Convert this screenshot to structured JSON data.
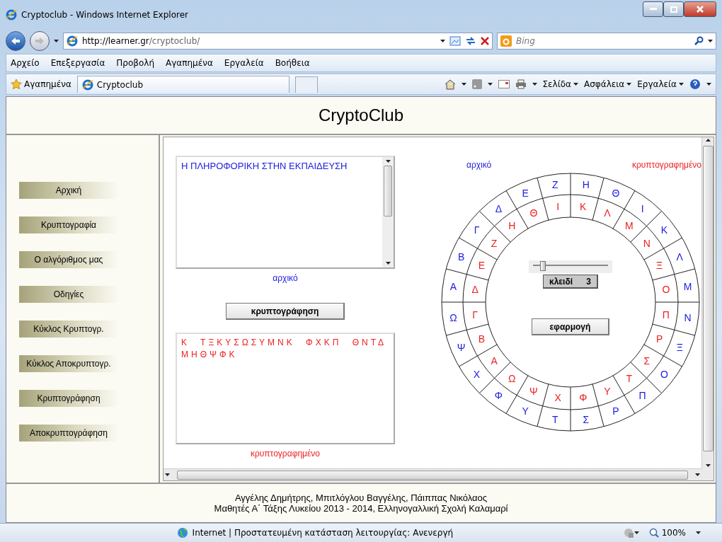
{
  "window": {
    "title": "Cryptoclub - Windows Internet Explorer"
  },
  "address_bar": {
    "url_host": "http://learner.gr",
    "url_path": "/cryptoclub/"
  },
  "search": {
    "placeholder": "Bing"
  },
  "menu": [
    "Αρχείο",
    "Επεξεργασία",
    "Προβολή",
    "Αγαπημένα",
    "Εργαλεία",
    "Βοήθεια"
  ],
  "favorites_bar": {
    "favorites": "Αγαπημένα",
    "tab": "Cryptoclub",
    "commands": [
      "Σελίδα",
      "Ασφάλεια",
      "Εργαλεία"
    ]
  },
  "page": {
    "title": "CryptoClub",
    "sidebar": {
      "items": [
        "Αρχική",
        "Κρυπτογραφία",
        "Ο αλγόριθμος μας",
        "Οδηγίες",
        "Κύκλος Κρυπτογρ.",
        "Κύκλος Αποκρυπτογρ.",
        "Κρυπτογράφηση",
        "Αποκρυπτογράφηση"
      ]
    },
    "plaintext": {
      "value": "Η ΠΛΗΡΟΦΟΡΙΚΗ ΣΤΗΝ ΕΚΠΑΙΔΕΥΣΗ",
      "label": "αρχικό"
    },
    "encrypt_button": "κρυπτογράφηση",
    "ciphertext": {
      "value": "Κ ΤΞΚΥΣΩΣΥΜΝΚ ΦΧΚΠ ΘΝΤΔ ΜΗΘΨΦΚ",
      "label": "κρυπτογραφημένο"
    },
    "wheel": {
      "outer_label": "αρχικό",
      "inner_label": "κρυπτογραφημένο",
      "outer": [
        "Η",
        "Θ",
        "Ι",
        "Κ",
        "Λ",
        "Μ",
        "Ν",
        "Ξ",
        "Ο",
        "Π",
        "Ρ",
        "Σ",
        "Τ",
        "Υ",
        "Φ",
        "Χ",
        "Ψ",
        "Ω",
        "Α",
        "Β",
        "Γ",
        "Δ",
        "Ε",
        "Ζ"
      ],
      "inner": [
        "Κ",
        "Λ",
        "Μ",
        "Ν",
        "Ξ",
        "Ο",
        "Π",
        "Ρ",
        "Σ",
        "Τ",
        "Υ",
        "Φ",
        "Χ",
        "Ψ",
        "Ω",
        "Α",
        "Β",
        "Γ",
        "Δ",
        "Ε",
        "Ζ",
        "Η",
        "Θ",
        "Ι"
      ],
      "slider": {
        "level": 0.13
      },
      "key_label": "κλειδί",
      "key_value": "3",
      "apply_button": "εφαρμογή"
    },
    "footer": [
      "Αγγέλης Δημήτρης, Μπιτλόγλου Βαγγέλης, Πάιππας Νικόλαος",
      "Μαθητές Α΄ Τάξης Λυκείου 2013 - 2014, Ελληνογαλλική Σχολή Καλαμαρί"
    ]
  },
  "status_bar": {
    "text": "Internet | Προστατευμένη κατάσταση λειτουργίας: Ανενεργή",
    "zoom": "100%"
  }
}
